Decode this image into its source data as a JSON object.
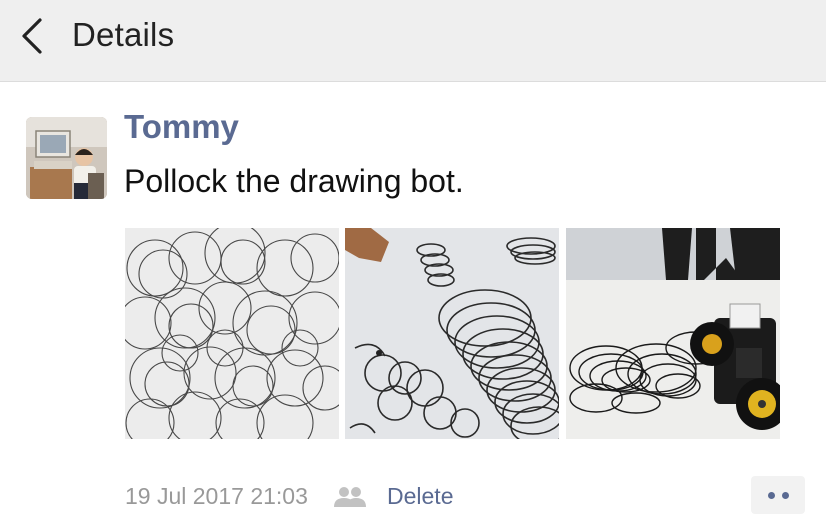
{
  "header": {
    "title": "Details",
    "back_icon": "chevron-left-icon"
  },
  "post": {
    "author": "Tommy",
    "text": "Pollock the drawing bot.",
    "photos": [
      {
        "name": "photo-scribble-circles"
      },
      {
        "name": "photo-spiral-drawing"
      },
      {
        "name": "photo-robot-car"
      }
    ],
    "timestamp": "19 Jul 2017 21:03",
    "privacy_icon": "friends-icon",
    "delete_label": "Delete",
    "more_icon": "more-dots-icon"
  },
  "colors": {
    "header_bg": "#efefef",
    "link": "#5a6a92",
    "meta_text": "#999999",
    "body_text": "#111111"
  }
}
